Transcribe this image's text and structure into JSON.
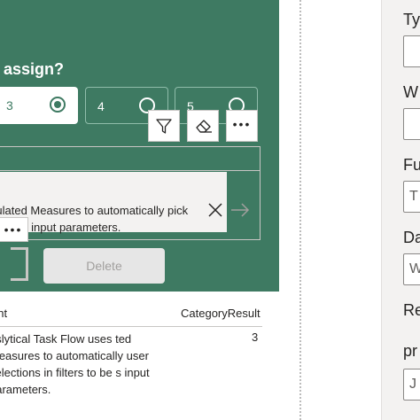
{
  "panel": {
    "question": "o assign?",
    "options": [
      {
        "label": "3",
        "selected": true
      },
      {
        "label": "4",
        "selected": false
      },
      {
        "label": "5",
        "selected": false
      }
    ],
    "toolbar": {
      "filter_icon": "filter-icon",
      "eraser_icon": "eraser-icon",
      "more_label": "•••"
    },
    "tooltip_text": "lculated Measures to automatically pick used as input parameters.",
    "dots_label": "•••",
    "delete_label": "Delete"
  },
  "table": {
    "headers": [
      "ent",
      "CategoryResult"
    ],
    "rows": [
      {
        "text": "nslytical Task Flow uses ted Measures to automatically user selections in filters to be s input parameters.",
        "value": "3"
      }
    ]
  },
  "right_panel": {
    "labels": [
      "Ty",
      "W",
      "Fu",
      "Da",
      "Re",
      "pr"
    ],
    "input_values": [
      "",
      "",
      "T",
      "W",
      "",
      "J"
    ]
  },
  "colors": {
    "accent_green": "#3e7a62",
    "panel_gray": "#f3f2f1"
  }
}
